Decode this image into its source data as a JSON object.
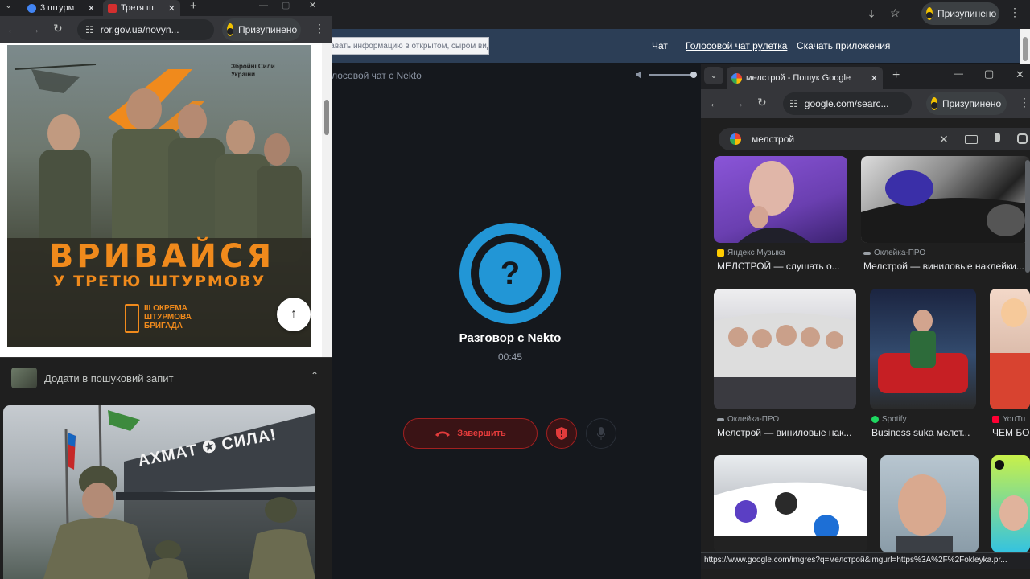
{
  "background_window": {
    "toolbar": {
      "profile_label": "Призупинено"
    },
    "nav": {
      "notice": "Не передавать информацию в открытом, сыром виде!",
      "chat_link": "Чат",
      "voice_roulette_link": "Голосовой чат рулетка",
      "download_link": "Скачать приложения"
    },
    "subheader": {
      "title": "Голосовой чат с Nekto"
    },
    "call": {
      "title": "Разговор с Nekto",
      "timer": "00:45",
      "avatar_symbol": "?",
      "end_label": "Завершить"
    },
    "colors": {
      "accent": "#2296d6",
      "danger": "#e23b3b",
      "nav_bg": "#2c3e56"
    }
  },
  "left_window": {
    "tabs": [
      {
        "label": "3 штурм",
        "active": false
      },
      {
        "label": "Третя ш",
        "active": true
      }
    ],
    "toolbar": {
      "url": "ror.gov.ua/novyn...",
      "profile_label": "Призупинено"
    },
    "poster": {
      "org": "Збройні Сили України",
      "headline": "ВРИВАЙСЯ",
      "subline": "У ТРЕТЮ ШТУРМОВУ",
      "brigade": "III ОКРЕМА ШТУРМОВА БРИГАДА"
    },
    "related": {
      "label": "Додати в пошуковий запит"
    },
    "image2": {
      "sign_text": "АХМАТ ✪ СИЛА!"
    }
  },
  "right_window": {
    "tab": {
      "title": "мелстрой - Пошук Google"
    },
    "toolbar": {
      "url": "google.com/searc...",
      "profile_label": "Призупинено"
    },
    "search": {
      "query": "мелстрой"
    },
    "results": [
      {
        "source": "Яндекс Музыка",
        "title": "МЕЛСТРОЙ — слушать о..."
      },
      {
        "source": "Оклейка-ПРО",
        "title": "Мелстрой — виниловые наклейки..."
      },
      {
        "source": "Оклейка-ПРО",
        "title": "Мелстрой — виниловые нак..."
      },
      {
        "source": "Spotify",
        "title": "Business suka мелст..."
      },
      {
        "source": "YouTu",
        "title": "ЧЕМ БО"
      }
    ],
    "status_url": "https://www.google.com/imgres?q=мелстрой&imgurl=https%3A%2F%2Fokleyka.pr...",
    "colors": {
      "yandex": "#ffcc00",
      "okleyka": "#9aa0a6",
      "spotify": "#1ed760",
      "youtube": "#ff0033"
    }
  }
}
